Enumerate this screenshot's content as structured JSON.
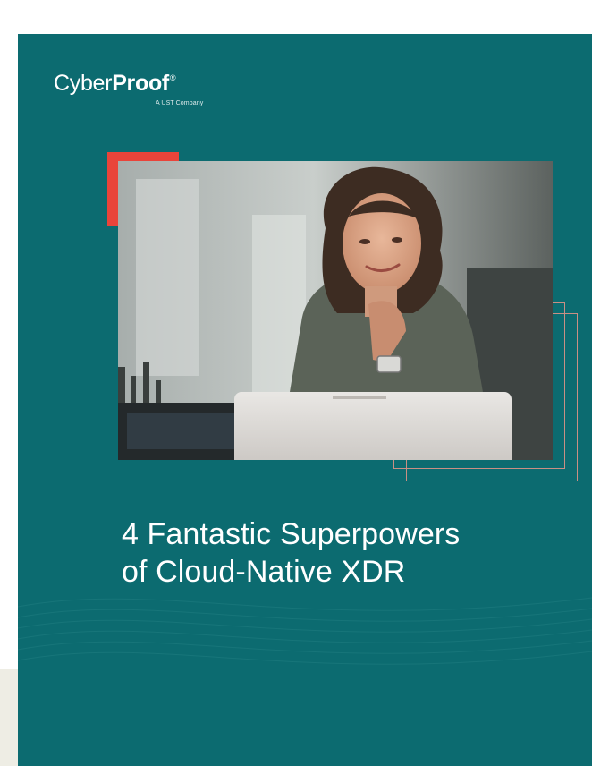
{
  "brand": {
    "name_light": "Cyber",
    "name_bold": "Proof",
    "registered": "®",
    "tagline": "A UST Company"
  },
  "cover": {
    "title_line1": "4 Fantastic Superpowers",
    "title_line2": "of Cloud-Native XDR",
    "photo_subject": "smiling-woman-at-laptop"
  },
  "colors": {
    "cover_bg": "#0c6b70",
    "accent_red": "#e9443a",
    "frame_line": "#c98f84",
    "side_strip": "#eeede4"
  }
}
